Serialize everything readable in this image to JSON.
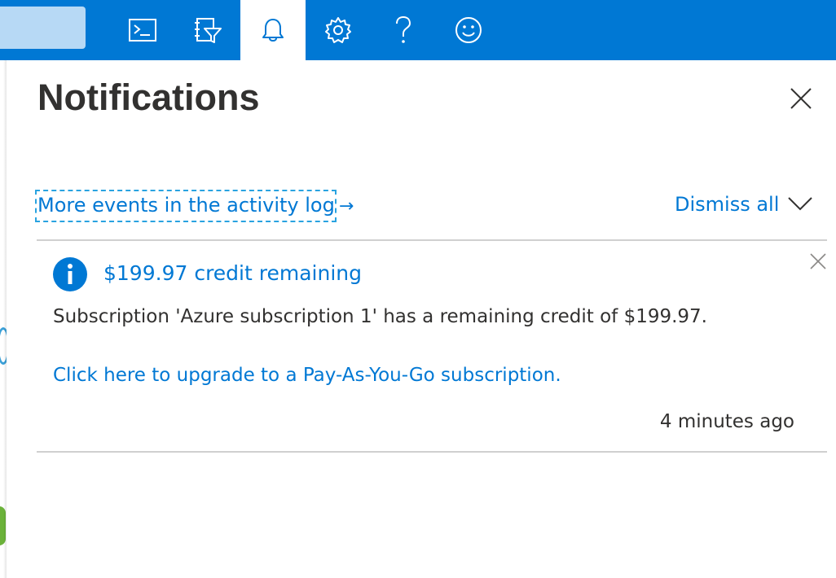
{
  "colors": {
    "accent": "#0078d4",
    "topbar": "#0078d4",
    "text": "#323130",
    "divider": "#d0d0d0",
    "focus_outline": "#29a3e0"
  },
  "topbar": {
    "search_value": "",
    "buttons": [
      {
        "icon": "cloud-shell-icon",
        "active": false
      },
      {
        "icon": "directory-filter-icon",
        "active": false
      },
      {
        "icon": "bell-icon",
        "active": true
      },
      {
        "icon": "gear-icon",
        "active": false
      },
      {
        "icon": "help-icon",
        "active": false
      },
      {
        "icon": "feedback-smiley-icon",
        "active": false
      }
    ]
  },
  "panel": {
    "title": "Notifications",
    "close_icon": "close-icon",
    "activity_link": "More events in the activity log",
    "activity_arrow": "→",
    "dismiss_all": "Dismiss all",
    "collapse_icon": "chevron-down-icon"
  },
  "notifications": [
    {
      "icon": "info-icon",
      "title": "$199.97 credit remaining",
      "body": "Subscription 'Azure subscription 1' has a remaining credit of $199.97.",
      "action": "Click here to upgrade to a Pay-As-You-Go subscription.",
      "time": "4 minutes ago"
    }
  ]
}
